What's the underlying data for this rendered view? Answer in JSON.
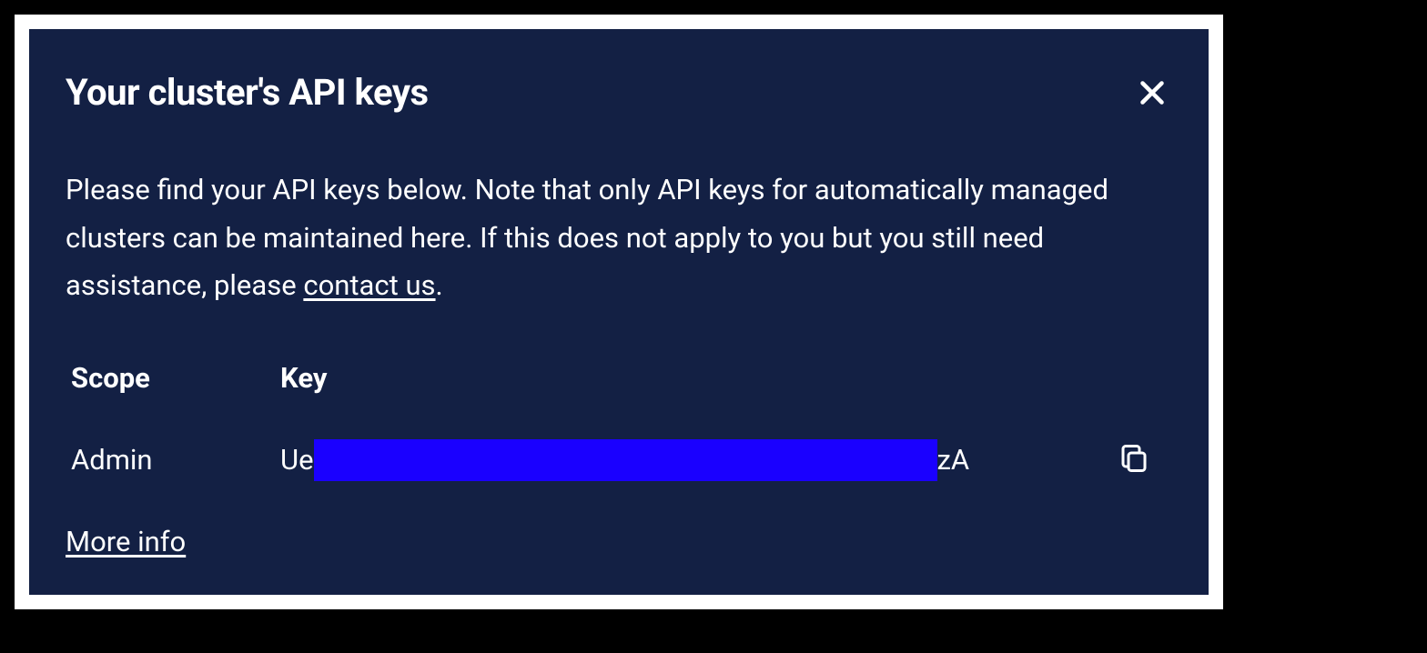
{
  "modal": {
    "title": "Your cluster's API keys",
    "description_part1": "Please find your API keys below. Note that only API keys for automatically managed clusters can be maintained here. If this does not apply to you but you still need assistance, please ",
    "contact_link": "contact us",
    "description_part2": "."
  },
  "table": {
    "headers": {
      "scope": "Scope",
      "key": "Key"
    },
    "rows": [
      {
        "scope": "Admin",
        "key_prefix": "Ue",
        "key_suffix": "zA"
      }
    ]
  },
  "footer": {
    "more_info": "More info"
  }
}
